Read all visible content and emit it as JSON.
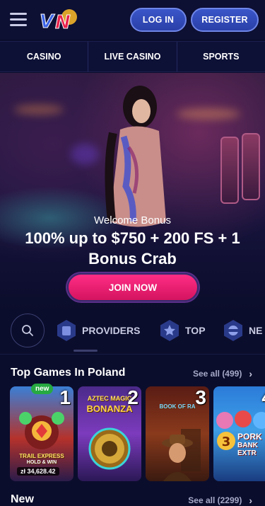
{
  "header": {
    "logo_text": "VN",
    "login_label": "LOG IN",
    "register_label": "REGISTER"
  },
  "categories": [
    "CASINO",
    "LIVE CASINO",
    "SPORTS"
  ],
  "hero": {
    "subtitle": "Welcome Bonus",
    "title": "100% up to $750 + 200 FS + 1 Bonus Crab",
    "cta_label": "JOIN NOW"
  },
  "filters": {
    "providers_label": "PROVIDERS",
    "top_label": "TOP",
    "new_label": "NE"
  },
  "top_games": {
    "title": "Top Games In Poland",
    "see_all": "See all (499)",
    "cards": [
      {
        "rank": "1",
        "badge": "new",
        "label": "TRAIL EXPRESS",
        "sublabel": "HOLD & WIN",
        "jackpot": "zł 34,628.42"
      },
      {
        "rank": "2",
        "label": "AZTEC MAGIC",
        "sublabel": "BONANZA"
      },
      {
        "rank": "3",
        "label": "BOOK OF RA"
      },
      {
        "rank": "4",
        "label": "PORK",
        "sublabel": "BANK EXTR"
      }
    ]
  },
  "new_section": {
    "title": "New",
    "see_all": "See all (2299)"
  },
  "icons": [
    "menu-icon",
    "search-icon",
    "providers-icon",
    "top-star-icon",
    "new-icon",
    "chevron-right-icon"
  ],
  "colors": {
    "background": "#0b0d2c",
    "accent_blue": "#2a3fa8",
    "accent_pink": "#ff2d86",
    "badge_green": "#27a941"
  }
}
